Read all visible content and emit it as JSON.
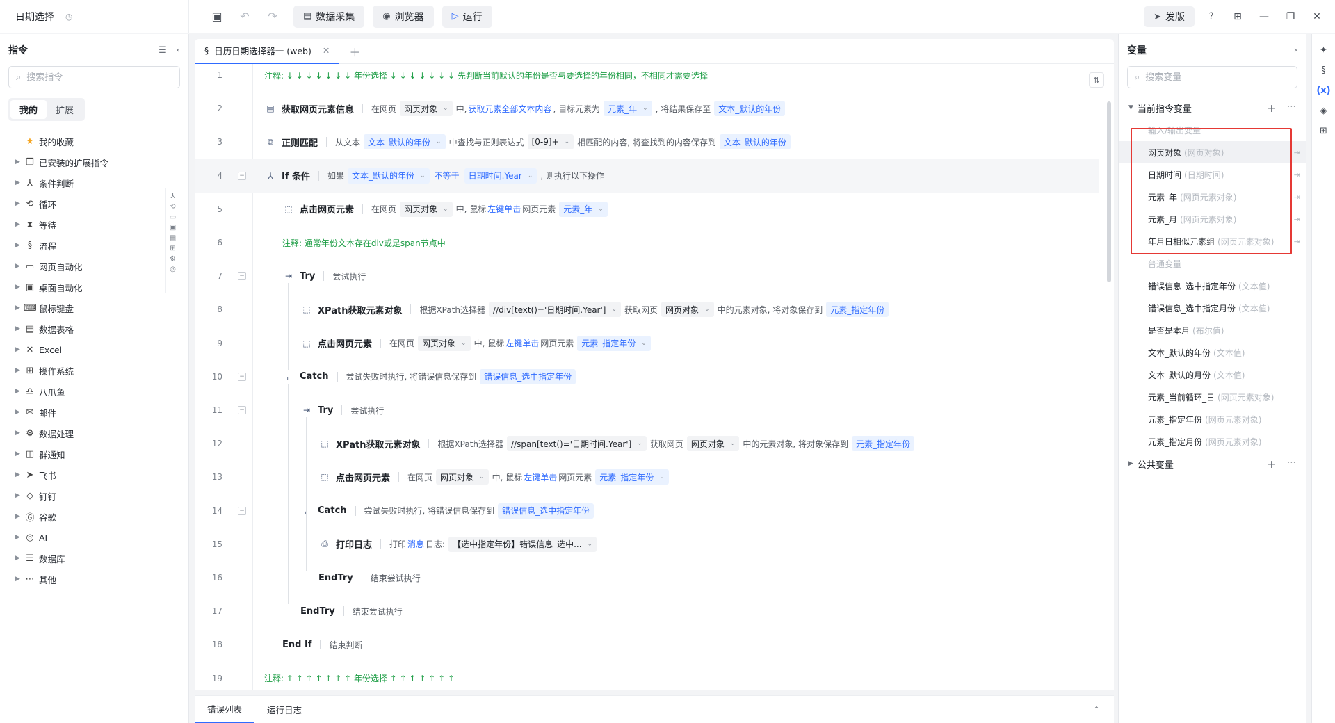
{
  "app": {
    "title": "日期选择",
    "toolbar": {
      "collect_label": "数据采集",
      "browser_label": "浏览器",
      "run_label": "运行"
    },
    "right_actions": {
      "publish_label": "发版"
    }
  },
  "left_panel": {
    "title": "指令",
    "search_placeholder": "搜索指令",
    "tabs": [
      {
        "label": "我的",
        "active": true
      },
      {
        "label": "扩展",
        "active": false
      }
    ],
    "categories": [
      {
        "label": "我的收藏",
        "icon": "★"
      },
      {
        "label": "已安装的扩展指令",
        "icon": "❒"
      },
      {
        "label": "条件判断",
        "icon": "⅄"
      },
      {
        "label": "循环",
        "icon": "⟲"
      },
      {
        "label": "等待",
        "icon": "⧗"
      },
      {
        "label": "流程",
        "icon": "§"
      },
      {
        "label": "网页自动化",
        "icon": "▭"
      },
      {
        "label": "桌面自动化",
        "icon": "▣"
      },
      {
        "label": "鼠标键盘",
        "icon": "⌨"
      },
      {
        "label": "数据表格",
        "icon": "▤"
      },
      {
        "label": "Excel",
        "icon": "✕"
      },
      {
        "label": "操作系统",
        "icon": "⊞"
      },
      {
        "label": "八爪鱼",
        "icon": "♎"
      },
      {
        "label": "邮件",
        "icon": "✉"
      },
      {
        "label": "数据处理",
        "icon": "⚙"
      },
      {
        "label": "群通知",
        "icon": "◫"
      },
      {
        "label": "飞书",
        "icon": "➤"
      },
      {
        "label": "钉钉",
        "icon": "◇"
      },
      {
        "label": "谷歌",
        "icon": "Ⓖ"
      },
      {
        "label": "AI",
        "icon": "◎"
      },
      {
        "label": "数据库",
        "icon": "☰"
      },
      {
        "label": "其他",
        "icon": "⋯"
      }
    ]
  },
  "editor": {
    "tab_label": "日历日期选择器一 (web)",
    "lines": [
      {
        "n": "1",
        "indent": 0,
        "comment": "注释: ↓ ↓ ↓ ↓ ↓ ↓ ↓ 年份选择 ↓ ↓ ↓ ↓ ↓ ↓ ↓ 先判断当前默认的年份是否与要选择的年份相同，不相同才需要选择"
      },
      {
        "n": "2",
        "indent": 0,
        "icon": "▤",
        "name": "获取网页元素信息",
        "parts": [
          {
            "t": "在网页"
          },
          {
            "c": "obj",
            "v": "网页对象",
            "dd": true
          },
          {
            "t": "中,"
          },
          {
            "k": "获取元素全部文本内容"
          },
          {
            "t": ", 目标元素为"
          },
          {
            "c": "var",
            "v": "元素_年",
            "dd": true
          },
          {
            "t": ", 将结果保存至"
          },
          {
            "c": "var",
            "v": "文本_默认的年份"
          }
        ]
      },
      {
        "n": "3",
        "indent": 0,
        "icon": "⧉",
        "name": "正则匹配",
        "parts": [
          {
            "t": "从文本"
          },
          {
            "c": "var",
            "v": "文本_默认的年份",
            "dd": true
          },
          {
            "t": "中查找与正则表达式"
          },
          {
            "c": "obj",
            "v": "[0-9]+",
            "dd": true
          },
          {
            "t": "相匹配的内容, 将查找到的内容保存到"
          },
          {
            "c": "var",
            "v": "文本_默认的年份"
          }
        ]
      },
      {
        "n": "4",
        "indent": 0,
        "icon": "⅄",
        "name": "If 条件",
        "fold": true,
        "hl": true,
        "parts": [
          {
            "t": "如果"
          },
          {
            "c": "var",
            "v": "文本_默认的年份",
            "dd": true
          },
          {
            "k": "不等于"
          },
          {
            "c": "var",
            "v": "日期时间.Year",
            "dd": true
          },
          {
            "t": ", 则执行以下操作"
          }
        ]
      },
      {
        "n": "5",
        "indent": 1,
        "icon": "⬚",
        "name": "点击网页元素",
        "parts": [
          {
            "t": "在网页"
          },
          {
            "c": "obj",
            "v": "网页对象",
            "dd": true
          },
          {
            "t": "中, 鼠标"
          },
          {
            "k": "左键单击"
          },
          {
            "t": "网页元素"
          },
          {
            "c": "var",
            "v": "元素_年",
            "dd": true
          }
        ]
      },
      {
        "n": "6",
        "indent": 1,
        "comment": "注释: 通常年份文本存在div或是span节点中"
      },
      {
        "n": "7",
        "indent": 1,
        "icon": "⇥",
        "name": "Try",
        "fold": true,
        "parts": [
          {
            "t": "尝试执行"
          }
        ]
      },
      {
        "n": "8",
        "indent": 2,
        "icon": "⬚",
        "name": "XPath获取元素对象",
        "parts": [
          {
            "t": "根据XPath选择器"
          },
          {
            "c": "obj",
            "v": "//div[text()='日期时间.Year']",
            "dd": true
          },
          {
            "t": "获取网页"
          },
          {
            "c": "obj",
            "v": "网页对象",
            "dd": true
          },
          {
            "t": "中的元素对象, 将对象保存到"
          },
          {
            "c": "var",
            "v": "元素_指定年份"
          }
        ]
      },
      {
        "n": "9",
        "indent": 2,
        "icon": "⬚",
        "name": "点击网页元素",
        "parts": [
          {
            "t": "在网页"
          },
          {
            "c": "obj",
            "v": "网页对象",
            "dd": true
          },
          {
            "t": "中, 鼠标"
          },
          {
            "k": "左键单击"
          },
          {
            "t": "网页元素"
          },
          {
            "c": "var",
            "v": "元素_指定年份",
            "dd": true
          }
        ]
      },
      {
        "n": "10",
        "indent": 1,
        "icon": "⌞",
        "name": "Catch",
        "fold": true,
        "parts": [
          {
            "t": "尝试失败时执行, 将错误信息保存到"
          },
          {
            "c": "var",
            "v": "错误信息_选中指定年份"
          }
        ]
      },
      {
        "n": "11",
        "indent": 2,
        "icon": "⇥",
        "name": "Try",
        "fold": true,
        "parts": [
          {
            "t": "尝试执行"
          }
        ]
      },
      {
        "n": "12",
        "indent": 3,
        "icon": "⬚",
        "name": "XPath获取元素对象",
        "parts": [
          {
            "t": "根据XPath选择器"
          },
          {
            "c": "obj",
            "v": "//span[text()='日期时间.Year']",
            "dd": true
          },
          {
            "t": "获取网页"
          },
          {
            "c": "obj",
            "v": "网页对象",
            "dd": true
          },
          {
            "t": "中的元素对象, 将对象保存到"
          },
          {
            "c": "var",
            "v": "元素_指定年份"
          }
        ]
      },
      {
        "n": "13",
        "indent": 3,
        "icon": "⬚",
        "name": "点击网页元素",
        "parts": [
          {
            "t": "在网页"
          },
          {
            "c": "obj",
            "v": "网页对象",
            "dd": true
          },
          {
            "t": "中, 鼠标"
          },
          {
            "k": "左键单击"
          },
          {
            "t": "网页元素"
          },
          {
            "c": "var",
            "v": "元素_指定年份",
            "dd": true
          }
        ]
      },
      {
        "n": "14",
        "indent": 2,
        "icon": "⌞",
        "name": "Catch",
        "fold": true,
        "parts": [
          {
            "t": "尝试失败时执行, 将错误信息保存到"
          },
          {
            "c": "var",
            "v": "错误信息_选中指定年份"
          }
        ]
      },
      {
        "n": "15",
        "indent": 3,
        "icon": "⎙",
        "name": "打印日志",
        "parts": [
          {
            "t": "打印"
          },
          {
            "k": "消息"
          },
          {
            "t": "日志:"
          },
          {
            "c": "obj",
            "v": "【选中指定年份】错误信息_选中...",
            "dd": true
          }
        ]
      },
      {
        "n": "16",
        "indent": 3,
        "name": "EndTry",
        "parts": [
          {
            "t": "结束尝试执行"
          }
        ]
      },
      {
        "n": "17",
        "indent": 2,
        "name": "EndTry",
        "parts": [
          {
            "t": "结束尝试执行"
          }
        ]
      },
      {
        "n": "18",
        "indent": 1,
        "name": "End If",
        "parts": [
          {
            "t": "结束判断"
          }
        ]
      },
      {
        "n": "19",
        "indent": 0,
        "comment": "注释: ↑ ↑ ↑ ↑ ↑ ↑ ↑ 年份选择 ↑ ↑ ↑ ↑ ↑ ↑ ↑"
      }
    ]
  },
  "bottom": {
    "tabs": [
      {
        "label": "错误列表",
        "active": true
      },
      {
        "label": "运行日志",
        "active": false
      }
    ]
  },
  "right_panel": {
    "title": "变量",
    "search_placeholder": "搜索变量",
    "section_current": "当前指令变量",
    "sub_io": "输入/输出变量",
    "io_vars": [
      {
        "name": "网页对象",
        "type": "(网页对象)"
      },
      {
        "name": "日期时间",
        "type": "(日期时间)"
      },
      {
        "name": "元素_年",
        "type": "(网页元素对象)"
      },
      {
        "name": "元素_月",
        "type": "(网页元素对象)"
      },
      {
        "name": "年月日相似元素组",
        "type": "(网页元素对象)"
      }
    ],
    "sub_normal": "普通变量",
    "normal_vars": [
      {
        "name": "错误信息_选中指定年份",
        "type": "(文本值)"
      },
      {
        "name": "错误信息_选中指定月份",
        "type": "(文本值)"
      },
      {
        "name": "是否是本月",
        "type": "(布尔值)"
      },
      {
        "name": "文本_默认的年份",
        "type": "(文本值)"
      },
      {
        "name": "文本_默认的月份",
        "type": "(文本值)"
      },
      {
        "name": "元素_当前循环_日",
        "type": "(网页元素对象)"
      },
      {
        "name": "元素_指定年份",
        "type": "(网页元素对象)"
      },
      {
        "name": "元素_指定月份",
        "type": "(网页元素对象)"
      }
    ],
    "section_public": "公共变量"
  },
  "colors": {
    "accent": "#2f6bff",
    "comment": "#1e9e46",
    "highlight_box": "#e53935"
  }
}
